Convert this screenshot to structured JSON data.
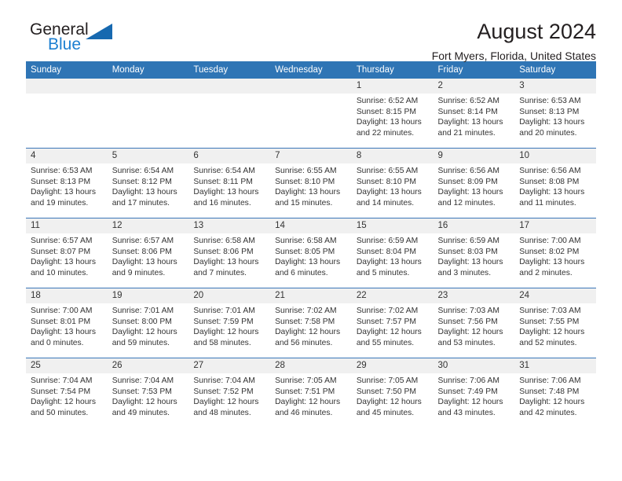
{
  "logo": {
    "word_top": "General",
    "word_bottom": "Blue",
    "triangle_color": "#1769b0",
    "blue_text_color": "#1c7fd1"
  },
  "header": {
    "title": "August 2024",
    "subtitle": "Fort Myers, Florida, United States",
    "header_bar_color": "#2f75b5",
    "row_divider_color": "#3a76b8",
    "daynum_band_color": "#f0f0f0"
  },
  "weekdays": [
    "Sunday",
    "Monday",
    "Tuesday",
    "Wednesday",
    "Thursday",
    "Friday",
    "Saturday"
  ],
  "weeks": [
    [
      {
        "day": "",
        "empty": true
      },
      {
        "day": "",
        "empty": true
      },
      {
        "day": "",
        "empty": true
      },
      {
        "day": "",
        "empty": true
      },
      {
        "day": "1",
        "sunrise": "Sunrise: 6:52 AM",
        "sunset": "Sunset: 8:15 PM",
        "daylight": "Daylight: 13 hours and 22 minutes."
      },
      {
        "day": "2",
        "sunrise": "Sunrise: 6:52 AM",
        "sunset": "Sunset: 8:14 PM",
        "daylight": "Daylight: 13 hours and 21 minutes."
      },
      {
        "day": "3",
        "sunrise": "Sunrise: 6:53 AM",
        "sunset": "Sunset: 8:13 PM",
        "daylight": "Daylight: 13 hours and 20 minutes."
      }
    ],
    [
      {
        "day": "4",
        "sunrise": "Sunrise: 6:53 AM",
        "sunset": "Sunset: 8:13 PM",
        "daylight": "Daylight: 13 hours and 19 minutes."
      },
      {
        "day": "5",
        "sunrise": "Sunrise: 6:54 AM",
        "sunset": "Sunset: 8:12 PM",
        "daylight": "Daylight: 13 hours and 17 minutes."
      },
      {
        "day": "6",
        "sunrise": "Sunrise: 6:54 AM",
        "sunset": "Sunset: 8:11 PM",
        "daylight": "Daylight: 13 hours and 16 minutes."
      },
      {
        "day": "7",
        "sunrise": "Sunrise: 6:55 AM",
        "sunset": "Sunset: 8:10 PM",
        "daylight": "Daylight: 13 hours and 15 minutes."
      },
      {
        "day": "8",
        "sunrise": "Sunrise: 6:55 AM",
        "sunset": "Sunset: 8:10 PM",
        "daylight": "Daylight: 13 hours and 14 minutes."
      },
      {
        "day": "9",
        "sunrise": "Sunrise: 6:56 AM",
        "sunset": "Sunset: 8:09 PM",
        "daylight": "Daylight: 13 hours and 12 minutes."
      },
      {
        "day": "10",
        "sunrise": "Sunrise: 6:56 AM",
        "sunset": "Sunset: 8:08 PM",
        "daylight": "Daylight: 13 hours and 11 minutes."
      }
    ],
    [
      {
        "day": "11",
        "sunrise": "Sunrise: 6:57 AM",
        "sunset": "Sunset: 8:07 PM",
        "daylight": "Daylight: 13 hours and 10 minutes."
      },
      {
        "day": "12",
        "sunrise": "Sunrise: 6:57 AM",
        "sunset": "Sunset: 8:06 PM",
        "daylight": "Daylight: 13 hours and 9 minutes."
      },
      {
        "day": "13",
        "sunrise": "Sunrise: 6:58 AM",
        "sunset": "Sunset: 8:06 PM",
        "daylight": "Daylight: 13 hours and 7 minutes."
      },
      {
        "day": "14",
        "sunrise": "Sunrise: 6:58 AM",
        "sunset": "Sunset: 8:05 PM",
        "daylight": "Daylight: 13 hours and 6 minutes."
      },
      {
        "day": "15",
        "sunrise": "Sunrise: 6:59 AM",
        "sunset": "Sunset: 8:04 PM",
        "daylight": "Daylight: 13 hours and 5 minutes."
      },
      {
        "day": "16",
        "sunrise": "Sunrise: 6:59 AM",
        "sunset": "Sunset: 8:03 PM",
        "daylight": "Daylight: 13 hours and 3 minutes."
      },
      {
        "day": "17",
        "sunrise": "Sunrise: 7:00 AM",
        "sunset": "Sunset: 8:02 PM",
        "daylight": "Daylight: 13 hours and 2 minutes."
      }
    ],
    [
      {
        "day": "18",
        "sunrise": "Sunrise: 7:00 AM",
        "sunset": "Sunset: 8:01 PM",
        "daylight": "Daylight: 13 hours and 0 minutes."
      },
      {
        "day": "19",
        "sunrise": "Sunrise: 7:01 AM",
        "sunset": "Sunset: 8:00 PM",
        "daylight": "Daylight: 12 hours and 59 minutes."
      },
      {
        "day": "20",
        "sunrise": "Sunrise: 7:01 AM",
        "sunset": "Sunset: 7:59 PM",
        "daylight": "Daylight: 12 hours and 58 minutes."
      },
      {
        "day": "21",
        "sunrise": "Sunrise: 7:02 AM",
        "sunset": "Sunset: 7:58 PM",
        "daylight": "Daylight: 12 hours and 56 minutes."
      },
      {
        "day": "22",
        "sunrise": "Sunrise: 7:02 AM",
        "sunset": "Sunset: 7:57 PM",
        "daylight": "Daylight: 12 hours and 55 minutes."
      },
      {
        "day": "23",
        "sunrise": "Sunrise: 7:03 AM",
        "sunset": "Sunset: 7:56 PM",
        "daylight": "Daylight: 12 hours and 53 minutes."
      },
      {
        "day": "24",
        "sunrise": "Sunrise: 7:03 AM",
        "sunset": "Sunset: 7:55 PM",
        "daylight": "Daylight: 12 hours and 52 minutes."
      }
    ],
    [
      {
        "day": "25",
        "sunrise": "Sunrise: 7:04 AM",
        "sunset": "Sunset: 7:54 PM",
        "daylight": "Daylight: 12 hours and 50 minutes."
      },
      {
        "day": "26",
        "sunrise": "Sunrise: 7:04 AM",
        "sunset": "Sunset: 7:53 PM",
        "daylight": "Daylight: 12 hours and 49 minutes."
      },
      {
        "day": "27",
        "sunrise": "Sunrise: 7:04 AM",
        "sunset": "Sunset: 7:52 PM",
        "daylight": "Daylight: 12 hours and 48 minutes."
      },
      {
        "day": "28",
        "sunrise": "Sunrise: 7:05 AM",
        "sunset": "Sunset: 7:51 PM",
        "daylight": "Daylight: 12 hours and 46 minutes."
      },
      {
        "day": "29",
        "sunrise": "Sunrise: 7:05 AM",
        "sunset": "Sunset: 7:50 PM",
        "daylight": "Daylight: 12 hours and 45 minutes."
      },
      {
        "day": "30",
        "sunrise": "Sunrise: 7:06 AM",
        "sunset": "Sunset: 7:49 PM",
        "daylight": "Daylight: 12 hours and 43 minutes."
      },
      {
        "day": "31",
        "sunrise": "Sunrise: 7:06 AM",
        "sunset": "Sunset: 7:48 PM",
        "daylight": "Daylight: 12 hours and 42 minutes."
      }
    ]
  ]
}
